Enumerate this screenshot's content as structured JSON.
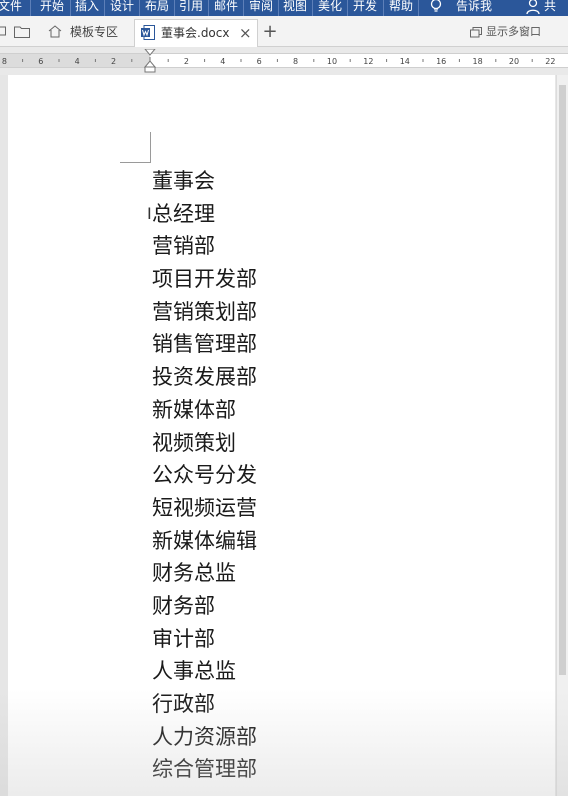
{
  "ribbon": {
    "menu": [
      {
        "label": "文件"
      },
      {
        "label": "开始"
      },
      {
        "label": "插入"
      },
      {
        "label": "设计"
      },
      {
        "label": "布局"
      },
      {
        "label": "引用"
      },
      {
        "label": "邮件"
      },
      {
        "label": "审阅"
      },
      {
        "label": "视图"
      },
      {
        "label": "美化"
      },
      {
        "label": "开发"
      },
      {
        "label": "帮助"
      }
    ],
    "tell_me": "告诉我",
    "share": "共"
  },
  "tabs": {
    "home_label": "模板专区",
    "doc_label": "董事会.docx",
    "close_label": "×",
    "new_tab_label": "+",
    "multi_window_label": "显示多窗口"
  },
  "ruler": {
    "labels": [
      "8",
      "6",
      "4",
      "2",
      "2",
      "4",
      "6",
      "8",
      "10",
      "12",
      "14",
      "16",
      "18",
      "20",
      "22"
    ]
  },
  "document": {
    "lines": [
      "董事会",
      "总经理",
      "营销部",
      "项目开发部",
      "营销策划部",
      "销售管理部",
      "投资发展部",
      "新媒体部",
      "视频策划",
      "公众号分发",
      "短视频运营",
      "新媒体编辑",
      "财务总监",
      "财务部",
      "审计部",
      "人事总监",
      "行政部",
      "人力资源部",
      "综合管理部"
    ]
  },
  "colors": {
    "ribbon": "#2b579a",
    "word_icon": "#2b579a"
  }
}
